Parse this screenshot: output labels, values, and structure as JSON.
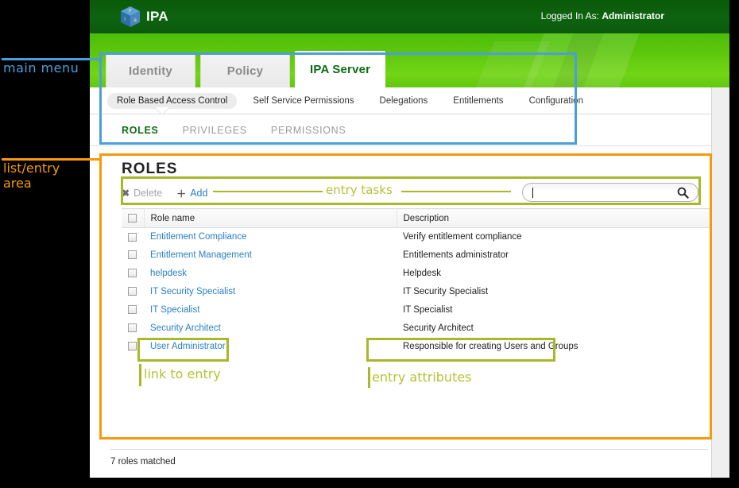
{
  "window": {
    "topbar": {
      "logo_text": "IPA",
      "logo_icon": "ipa-cube-logo",
      "logged_in_prefix": "Logged In As:",
      "logged_in_user": "Administrator"
    },
    "main_tabs": [
      {
        "label": "Identity",
        "active": false
      },
      {
        "label": "Policy",
        "active": false
      },
      {
        "label": "IPA Server",
        "active": true
      }
    ],
    "subnav": [
      {
        "label": "Role Based Access Control",
        "selected": true
      },
      {
        "label": "Self Service Permissions",
        "selected": false
      },
      {
        "label": "Delegations",
        "selected": false
      },
      {
        "label": "Entitlements",
        "selected": false
      },
      {
        "label": "Configuration",
        "selected": false
      }
    ],
    "facets": [
      {
        "label": "ROLES",
        "selected": true
      },
      {
        "label": "PRIVILEGES",
        "selected": false
      },
      {
        "label": "PERMISSIONS",
        "selected": false
      }
    ],
    "page_heading": "ROLES",
    "actions": [
      {
        "label": "Delete",
        "glyph": "✖",
        "icon": "delete-x-icon",
        "state": "disabled"
      },
      {
        "label": "Add",
        "glyph": "＋",
        "icon": "add-plus-icon",
        "state": "link"
      }
    ],
    "search": {
      "value": "",
      "placeholder": "",
      "icon": "search-magnifier-icon"
    },
    "table": {
      "columns": [
        "Role name",
        "Description"
      ],
      "select_all_checkbox": "select-all",
      "rows": [
        {
          "name": "Entitlement Compliance",
          "description": "Verify entitlement compliance"
        },
        {
          "name": "Entitlement Management",
          "description": "Entitlements administrator"
        },
        {
          "name": "helpdesk",
          "description": "Helpdesk"
        },
        {
          "name": "IT Security Specialist",
          "description": "IT Security Specialist"
        },
        {
          "name": "IT Specialist",
          "description": "IT Specialist"
        },
        {
          "name": "Security Architect",
          "description": "Security Architect"
        },
        {
          "name": "User Administrator",
          "description": "Responsible for creating Users and Groups"
        }
      ]
    },
    "footer_status": "7 roles matched"
  },
  "annotations": {
    "main_menu": "main menu",
    "list_entry_area_line1": "list/entry",
    "list_entry_area_line2": "area",
    "entry_tasks": "entry tasks",
    "link_to_entry": "link to entry",
    "entry_attributes": "entry attributes",
    "colors": {
      "blue": "#4a9fd8",
      "orange": "#f59a0a",
      "olive": "#a8b828",
      "olive_text": "#b5c233"
    }
  }
}
